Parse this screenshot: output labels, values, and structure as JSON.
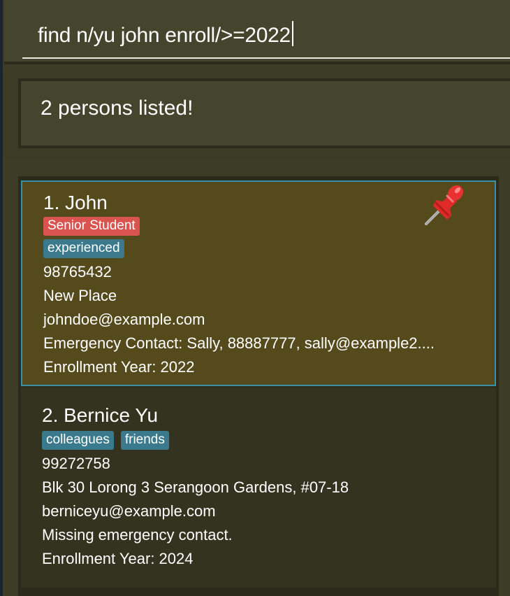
{
  "command": {
    "value": "find n/yu john enroll/>=2022"
  },
  "result": {
    "message": "2 persons listed!"
  },
  "persons": [
    {
      "name": "1. John",
      "tags": [
        {
          "label": "Senior Student",
          "color": "#d9534f"
        },
        {
          "label": "experienced",
          "color": "#3a7a8c"
        }
      ],
      "phone": "98765432",
      "address": "New Place",
      "email": "johndoe@example.com",
      "emergency": "Emergency Contact: Sally, 88887777, sally@example2....",
      "enrollment": "Enrollment Year: 2022",
      "pinned": true,
      "selected": true
    },
    {
      "name": "2. Bernice Yu",
      "tags": [
        {
          "label": "colleagues",
          "color": "#3a7a8c"
        },
        {
          "label": "friends",
          "color": "#3a7a8c"
        }
      ],
      "phone": "99272758",
      "address": "Blk 30 Lorong 3 Serangoon Gardens, #07-18",
      "email": "berniceyu@example.com",
      "emergency": "Missing emergency contact.",
      "enrollment": "Enrollment Year: 2024",
      "pinned": false,
      "selected": false
    }
  ],
  "icons": {
    "pin": "pushpin-icon"
  },
  "colors": {
    "background": "#3d3d27",
    "selected_card": "#554a1c",
    "selected_border": "#3a8fa6",
    "card": "#34331f"
  }
}
